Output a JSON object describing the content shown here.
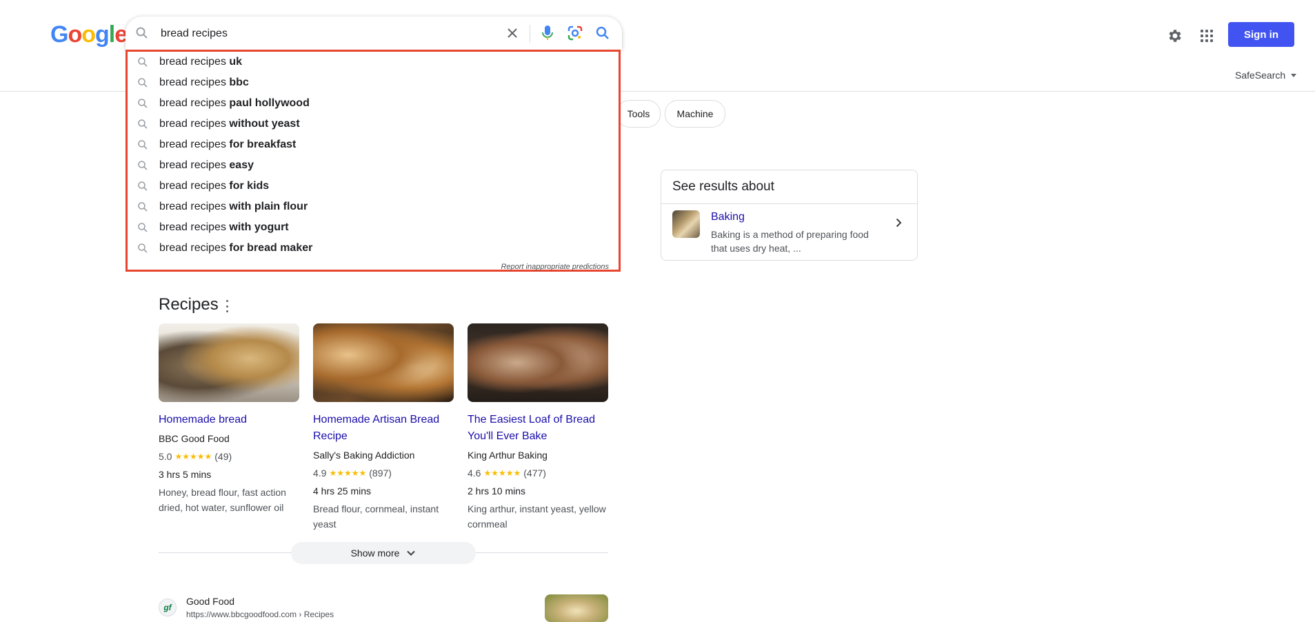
{
  "search": {
    "query": "bread recipes",
    "clear_label": "Clear",
    "voice_label": "Search by voice",
    "lens_label": "Search by image",
    "submit_label": "Search"
  },
  "header": {
    "logo_letters": [
      "G",
      "o",
      "o",
      "g",
      "l",
      "e"
    ],
    "signin_label": "Sign in",
    "safesearch_label": "SafeSearch"
  },
  "suggestions": [
    {
      "prefix": "bread recipes",
      "completion": "uk"
    },
    {
      "prefix": "bread recipes",
      "completion": "bbc"
    },
    {
      "prefix": "bread recipes",
      "completion": "paul hollywood"
    },
    {
      "prefix": "bread recipes",
      "completion": "without yeast"
    },
    {
      "prefix": "bread recipes",
      "completion": "for breakfast"
    },
    {
      "prefix": "bread recipes",
      "completion": "easy"
    },
    {
      "prefix": "bread recipes",
      "completion": "for kids"
    },
    {
      "prefix": "bread recipes",
      "completion": "with plain flour"
    },
    {
      "prefix": "bread recipes",
      "completion": "with yogurt"
    },
    {
      "prefix": "bread recipes",
      "completion": "for bread maker"
    }
  ],
  "report_label": "Report inappropriate predictions",
  "chips": [
    "Tools",
    "Machine"
  ],
  "knowledge_panel": {
    "title": "See results about",
    "link": "Baking",
    "description": "Baking is a method of preparing food that uses dry heat, ..."
  },
  "recipes": {
    "title": "Recipes",
    "show_more": "Show more",
    "cards": [
      {
        "title": "Homemade bread",
        "source": "BBC Good Food",
        "rating": "5.0",
        "stars": "★★★★★",
        "reviews": "(49)",
        "time": "3 hrs 5 mins",
        "ingredients": "Honey, bread flour, fast action dried, hot water, sunflower oil"
      },
      {
        "title": "Homemade Artisan Bread Recipe",
        "source": "Sally's Baking Addiction",
        "rating": "4.9",
        "stars": "★★★★★",
        "reviews": "(897)",
        "time": "4 hrs 25 mins",
        "ingredients": "Bread flour, cornmeal, instant yeast"
      },
      {
        "title": "The Easiest Loaf of Bread You'll Ever Bake",
        "source": "King Arthur Baking",
        "rating": "4.6",
        "stars": "★★★★★",
        "reviews": "(477)",
        "time": "2 hrs 10 mins",
        "ingredients": "King arthur, instant yeast, yellow cornmeal"
      }
    ]
  },
  "result": {
    "favicon": "gf",
    "site": "Good Food",
    "url": "https://www.bbcgoodfood.com › Recipes"
  },
  "colors": {
    "accent": "#4154f1",
    "link": "#1a0dab",
    "highlight_border": "#e8452f",
    "stars": "#fbbc04"
  }
}
